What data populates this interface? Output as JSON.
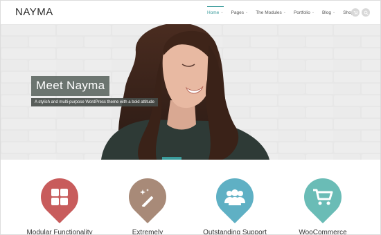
{
  "site": {
    "logo": "NAYMA"
  },
  "nav": {
    "items": [
      {
        "label": "Home",
        "active": true,
        "has_dropdown": true
      },
      {
        "label": "Pages",
        "active": false,
        "has_dropdown": true
      },
      {
        "label": "The Modules",
        "active": false,
        "has_dropdown": true
      },
      {
        "label": "Portfolio",
        "active": false,
        "has_dropdown": true
      },
      {
        "label": "Blog",
        "active": false,
        "has_dropdown": true
      },
      {
        "label": "Shop",
        "active": false,
        "has_dropdown": true
      }
    ],
    "icons": [
      "cart-icon",
      "search-icon"
    ],
    "accent": "#3a9b9b"
  },
  "hero": {
    "title": "Meet Nayma",
    "subtitle": "A stylish and multi-purpose WordPress theme with a bold attitude"
  },
  "features": [
    {
      "label": "Modular Functionality",
      "icon": "grid-icon",
      "color": "#c85c5c"
    },
    {
      "label": "Extremely",
      "icon": "magic-wand-icon",
      "color": "#a88a78"
    },
    {
      "label": "Outstanding Support",
      "icon": "users-icon",
      "color": "#5fb0c4"
    },
    {
      "label": "WooCommerce",
      "icon": "cart-icon",
      "color": "#6abcb6"
    }
  ]
}
